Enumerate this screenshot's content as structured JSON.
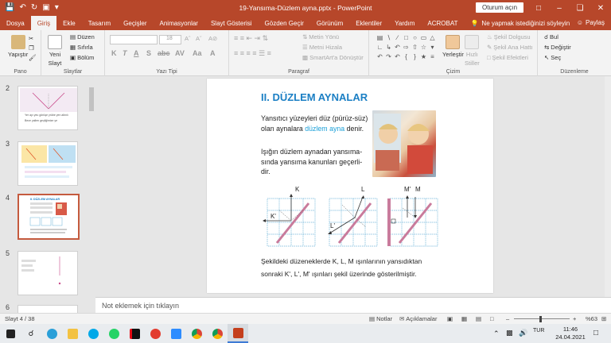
{
  "window": {
    "title": "19-Yansıma-Düzlem ayna.pptx  -  PowerPoint",
    "signin": "Oturum açın",
    "share": "Paylaş"
  },
  "tabs": [
    "Dosya",
    "Giriş",
    "Ekle",
    "Tasarım",
    "Geçişler",
    "Animasyonlar",
    "Slayt Gösterisi",
    "Gözden Geçir",
    "Görünüm",
    "Eklentiler",
    "Yardım",
    "ACROBAT"
  ],
  "active_tab": "Giriş",
  "tell_me": "Ne yapmak istediğinizi söyleyin",
  "ribbon": {
    "paste": "Yapıştır",
    "new_slide_1": "Yeni",
    "new_slide_2": "Slayt",
    "layout": "Düzen",
    "reset": "Sıfırla",
    "section": "Bölüm",
    "font_size": "18",
    "text_direction": "Metin Yönü",
    "align_text": "Metni Hizala",
    "smartart": "SmartArt'a Dönüştür",
    "arrange": "Yerleştir",
    "quick_styles_1": "Hızlı",
    "quick_styles_2": "Stiller",
    "shape_fill": "Şekil Dolgusu",
    "shape_outline": "Şekil Ana Hattı",
    "shape_effects": "Şekil Efektleri",
    "find": "Bul",
    "replace": "Değiştir",
    "select": "Seç",
    "groups": {
      "clipboard": "Pano",
      "slides": "Slaytlar",
      "font": "Yazı Tipi",
      "paragraph": "Paragraf",
      "drawing": "Çizim",
      "editing": "Düzenleme"
    }
  },
  "thumbnails": [
    {
      "num": "2",
      "line1": "Yer ayı yeu görüşe yrübe yen altınlı",
      "line2": "Bece yallen geçliğimize ye"
    },
    {
      "num": "3",
      "line1": "",
      "line2": ""
    },
    {
      "num": "4",
      "line1": "II. DÜZLEM AYNALAR",
      "line2": ""
    },
    {
      "num": "5",
      "line1": "",
      "line2": ""
    },
    {
      "num": "6",
      "line1": "",
      "line2": ""
    }
  ],
  "slide": {
    "title": "II. DÜZLEM AYNALAR",
    "p1_a": "Yansıtıcı yüzeyleri düz (pürüz-süz) olan aynalara ",
    "p1_hl": "düzlem ayna",
    "p1_b": " denir.",
    "p2": "Işığın düzlem aynadan yansıma-sında yansıma kanunları geçerli-dir.",
    "labels": {
      "k": "K",
      "k2": "K'",
      "l": "L",
      "l2": "L'",
      "m": "M",
      "m2": "M'"
    },
    "caption_1": "Şekildeki düzeneklerde K, L, M ışınlarının yansıdıktan",
    "caption_2": "sonraki K', L', M' ışınları şekil üzerinde gösterilmiştir."
  },
  "notes_placeholder": "Not eklemek için tıklayın",
  "status": {
    "slide_counter": "Slayt 4 / 38",
    "notes": "Notlar",
    "comments": "Açıklamalar",
    "zoom": "%63"
  },
  "taskbar": {
    "time": "11:46",
    "date": "24.04.2021"
  },
  "colors": {
    "accent": "#b7472a",
    "title_blue": "#1b7fc4",
    "highlight": "#1ba0d8"
  }
}
